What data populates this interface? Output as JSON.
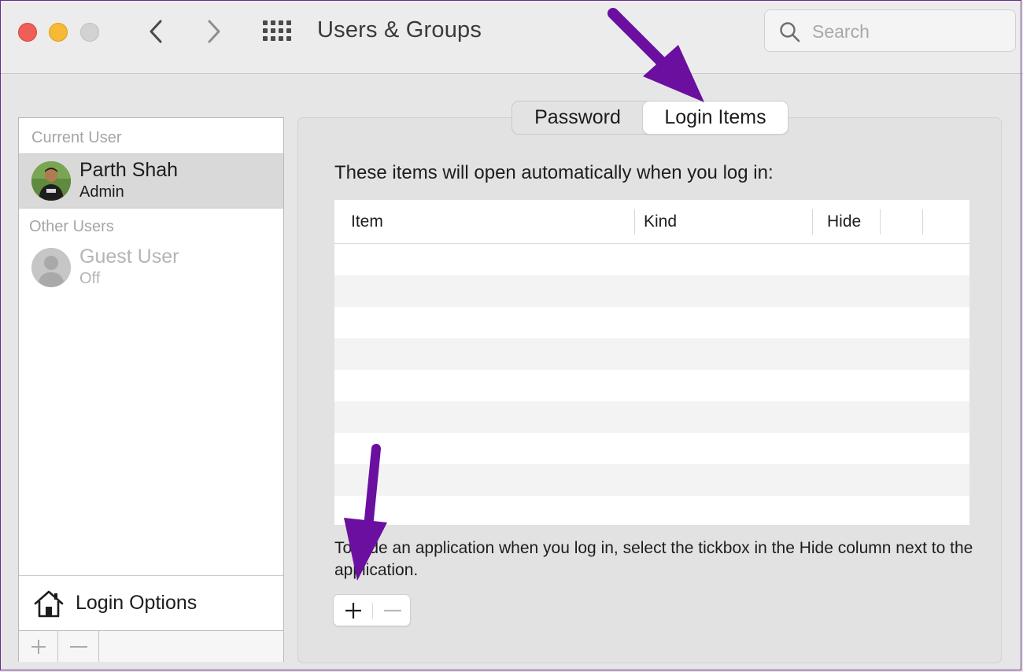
{
  "window": {
    "title": "Users & Groups"
  },
  "toolbar": {
    "back_icon": "chevron-left-icon",
    "forward_icon": "chevron-right-icon",
    "grid_icon": "show-all-grid-icon"
  },
  "search": {
    "placeholder": "Search",
    "value": ""
  },
  "sidebar": {
    "current_user_header": "Current User",
    "current_user": {
      "name": "Parth Shah",
      "role": "Admin"
    },
    "other_users_header": "Other Users",
    "other_users": [
      {
        "name": "Guest User",
        "status": "Off"
      }
    ],
    "login_options_label": "Login Options"
  },
  "tabs": {
    "password": "Password",
    "login_items": "Login Items",
    "selected": "Login Items"
  },
  "login_items": {
    "intro": "These items will open automatically when you log in:",
    "columns": [
      "Item",
      "Kind",
      "Hide"
    ],
    "rows": [],
    "footnote": "To hide an application when you log in, select the tickbox in the Hide column next to the application."
  },
  "colors": {
    "annotation_arrow": "#6a0fa0",
    "selected_row": "#d9d9d9"
  }
}
